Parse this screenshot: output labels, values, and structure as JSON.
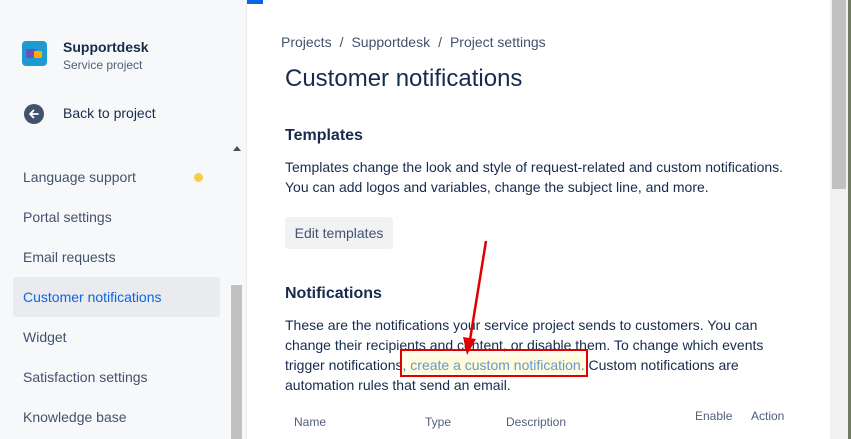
{
  "project": {
    "name": "Supportdesk",
    "type": "Service project"
  },
  "sidebar": {
    "back_label": "Back to project",
    "items": [
      {
        "label": "Language support",
        "badge": "yellow-dot"
      },
      {
        "label": "Portal settings"
      },
      {
        "label": "Email requests"
      },
      {
        "label": "Customer notifications",
        "active": true
      },
      {
        "label": "Widget"
      },
      {
        "label": "Satisfaction settings"
      },
      {
        "label": "Knowledge base"
      }
    ]
  },
  "breadcrumb": {
    "items": [
      "Projects",
      "Supportdesk",
      "Project settings"
    ],
    "separator": "/"
  },
  "page": {
    "title": "Customer notifications"
  },
  "templates": {
    "heading": "Templates",
    "description": "Templates change the look and style of request-related and custom notifications. You can add logos and variables, change the subject line, and more.",
    "edit_button": "Edit templates"
  },
  "notifications": {
    "heading": "Notifications",
    "description_before": "These are the notifications your service project sends to customers. You can change their recipients and content, or disable them. To change which events trigger notifications, ",
    "link_text": "create a custom notification",
    "description_after": ". Custom notifications are automation rules that send an email."
  },
  "table": {
    "columns": [
      "Name",
      "Type",
      "Description",
      "Enable",
      "Action"
    ]
  },
  "colors": {
    "accent": "#0c66e4",
    "active_nav_bg": "#e9ebee",
    "badge_yellow": "#f5cd47",
    "annotation_red": "#e00000"
  },
  "icons": {
    "back": "arrow-left-icon",
    "project_avatar": "project-avatar-icon"
  }
}
